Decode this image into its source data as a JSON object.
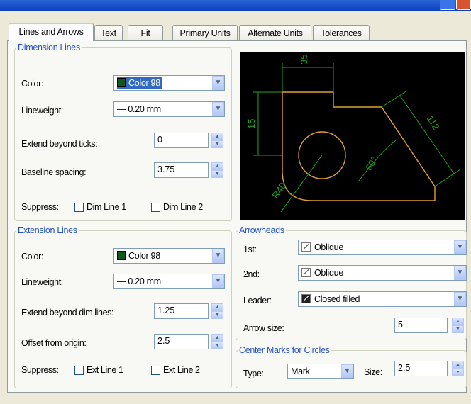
{
  "tabs": [
    "Lines and Arrows",
    "Text",
    "Fit",
    "Primary Units",
    "Alternate Units",
    "Tolerances"
  ],
  "dimension_lines": {
    "title": "Dimension Lines",
    "color_label": "Color:",
    "color_value": "Color 98",
    "lineweight_label": "Lineweight:",
    "lineweight_value": "— 0.20 mm",
    "extend_label": "Extend beyond ticks:",
    "extend_value": "0",
    "baseline_label": "Baseline spacing:",
    "baseline_value": "3.75",
    "suppress_label": "Suppress:",
    "dim_line1": "Dim Line 1",
    "dim_line2": "Dim Line 2"
  },
  "extension_lines": {
    "title": "Extension Lines",
    "color_label": "Color:",
    "color_value": "Color 98",
    "lineweight_label": "Lineweight:",
    "lineweight_value": "— 0.20 mm",
    "extend_label": "Extend beyond dim lines:",
    "extend_value": "1.25",
    "offset_label": "Offset from origin:",
    "offset_value": "2.5",
    "suppress_label": "Suppress:",
    "ext_line1": "Ext Line 1",
    "ext_line2": "Ext Line 2"
  },
  "arrowheads": {
    "title": "Arrowheads",
    "first_label": "1st:",
    "first_value": "Oblique",
    "second_label": "2nd:",
    "second_value": "Oblique",
    "leader_label": "Leader:",
    "leader_value": "Closed filled",
    "size_label": "Arrow size:",
    "size_value": "5"
  },
  "center_marks": {
    "title": "Center Marks for Circles",
    "type_label": "Type:",
    "type_value": "Mark",
    "size_label": "Size:",
    "size_value": "2.5"
  },
  "preview": {
    "dim_top": "35",
    "dim_left": "15",
    "dim_right": "112",
    "dim_angle": "60°",
    "dim_radius": "R40"
  },
  "colors": {
    "dim_color": "#0e5a1a",
    "geometry": "#e0a030",
    "dimension_preview": "#1fa51f",
    "selection": "#316ac5",
    "title_bar": "#0a3fb8"
  }
}
